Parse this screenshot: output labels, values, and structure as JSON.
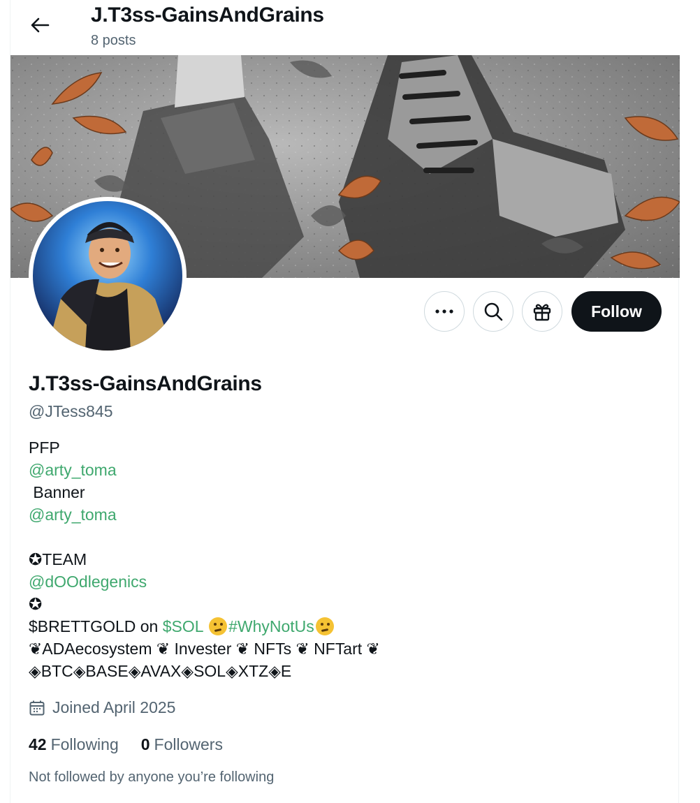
{
  "header": {
    "name": "J.T3ss-GainsAndGrains",
    "posts": "8 posts"
  },
  "profile": {
    "display_name": "J.T3ss-GainsAndGrains",
    "handle": "@JTess845",
    "follow_label": "Follow"
  },
  "bio": {
    "pfp_label": "PFP",
    "pfp_link": "@arty_toma",
    "banner_label": " Banner",
    "banner_link": "@arty_toma",
    "team_label": "✪TEAM",
    "team_link": "@dOOdlegenics",
    "star": "✪",
    "brett_text": "$BRETTGOLD on ",
    "sol_link": "$SOL",
    "hashtag": "#WhyNotUs",
    "interests": "❦ADAecosystem ❦ Invester ❦ NFTs ❦ NFTart ❦",
    "chains": "◈BTC◈BASE◈AVAX◈SOL◈XTZ◈E"
  },
  "joined": "Joined April 2025",
  "stats": {
    "following_count": "42",
    "following_label": "Following",
    "followers_count": "0",
    "followers_label": "Followers"
  },
  "note": "Not followed by anyone you’re following",
  "icons": {
    "back": "arrow-left-icon",
    "more": "more-icon",
    "search": "search-icon",
    "gift": "gift-icon",
    "calendar": "calendar-icon",
    "thinking": "thinking-face-emoji"
  },
  "colors": {
    "link": "#3fa86e",
    "secondary_text": "#536471",
    "primary_text": "#0f1419",
    "follow_bg": "#0f1419"
  }
}
